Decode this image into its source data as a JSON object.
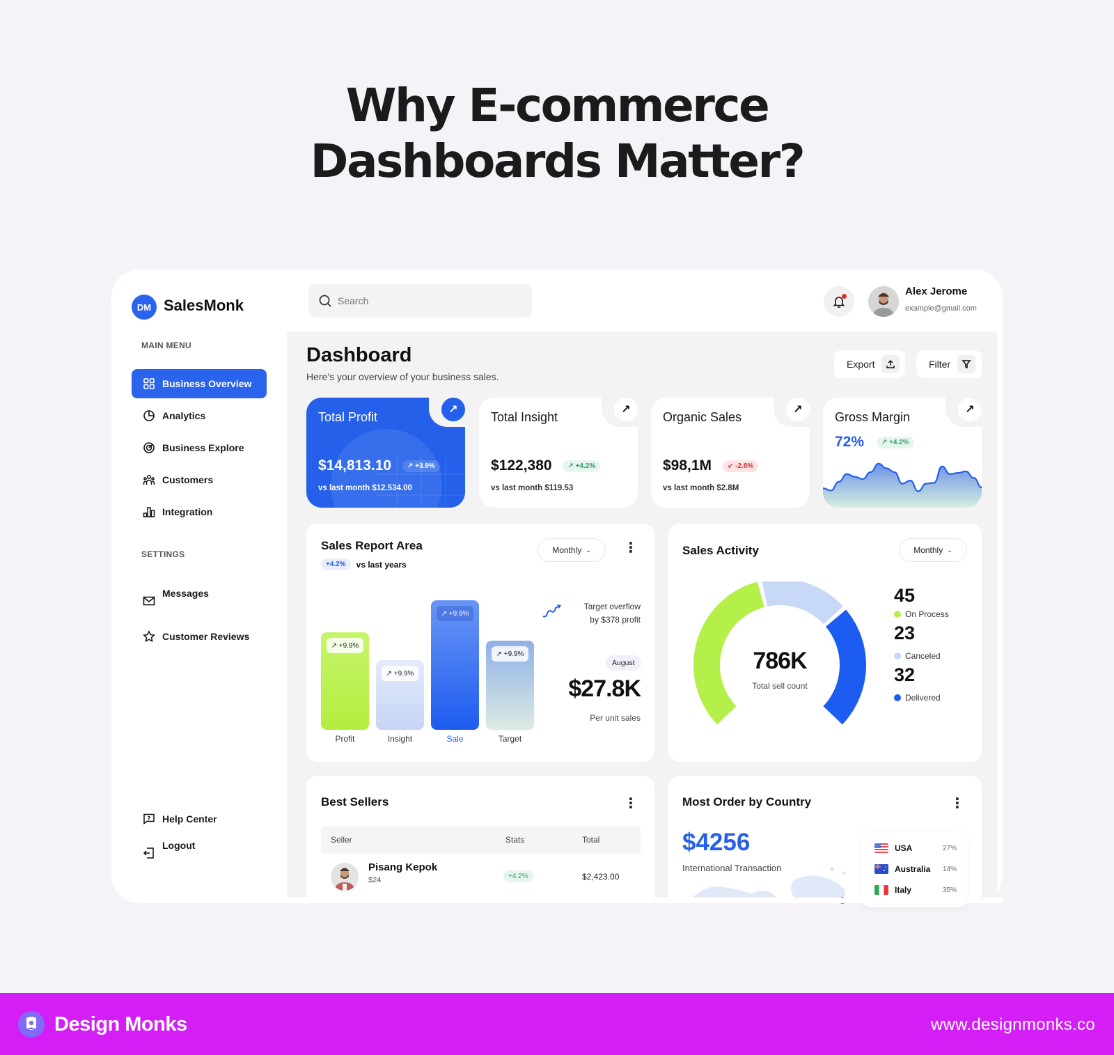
{
  "headline": {
    "line1": "Why E-commerce",
    "line2": "Dashboards Matter?"
  },
  "app": {
    "logo_initials": "DM",
    "name": "SalesMonk"
  },
  "sidebar": {
    "main_menu_label": "MAIN MENU",
    "main_items": [
      {
        "label": "Business Overview",
        "icon": "grid-icon",
        "active": true
      },
      {
        "label": "Analytics",
        "icon": "pie-chart-icon",
        "active": false
      },
      {
        "label": "Business Explore",
        "icon": "target-icon",
        "active": false
      },
      {
        "label": "Customers",
        "icon": "users-icon",
        "active": false
      },
      {
        "label": "Integration",
        "icon": "bar-chart-icon",
        "active": false
      }
    ],
    "settings_label": "SETTINGS",
    "settings_items": [
      {
        "label": "Messages",
        "icon": "mail-icon"
      },
      {
        "label": "Customer Reviews",
        "icon": "star-icon"
      }
    ],
    "bottom_items": [
      {
        "label": "Help Center",
        "icon": "help-icon"
      },
      {
        "label": "Logout",
        "icon": "logout-icon"
      }
    ]
  },
  "topbar": {
    "search_placeholder": "Search",
    "notification_unread": true,
    "user_name": "Alex Jerome",
    "user_email": "example@gmail.com"
  },
  "page": {
    "title": "Dashboard",
    "subtitle": "Here's your overview of your business sales.",
    "export_label": "Export",
    "filter_label": "Filter"
  },
  "stats": [
    {
      "title": "Total Profit",
      "value": "$14,813.10",
      "change": "↗ +3.9%",
      "trend": "up",
      "compare": "vs last month $12.534.00"
    },
    {
      "title": "Total Insight",
      "value": "$122,380",
      "change": "↗ +4.2%",
      "trend": "up",
      "compare": "vs last month $119.53"
    },
    {
      "title": "Organic Sales",
      "value": "$98,1M",
      "change": "↙ -2.8%",
      "trend": "down",
      "compare": "vs last month $2.8M"
    },
    {
      "title": "Gross Margin",
      "value": "72%",
      "change": "↗ +4.2%",
      "trend": "up"
    }
  ],
  "gross_margin_sparkline": [
    0.18,
    0.12,
    0.35,
    0.55,
    0.48,
    0.42,
    0.6,
    0.82,
    0.7,
    0.6,
    0.3,
    0.38,
    0.1,
    0.3,
    0.32,
    0.75,
    0.55,
    0.58,
    0.62,
    0.45,
    0.2
  ],
  "sales_report": {
    "title": "Sales Report Area",
    "change": "+4.2%",
    "change_label": "vs last years",
    "period": "Monthly",
    "note_line1": "Target overflow",
    "note_line2": "by $378 profit",
    "month": "August",
    "amount": "$27.8K",
    "amount_label": "Per unit sales"
  },
  "chart_data": [
    {
      "type": "bar",
      "title": "Sales Report Area",
      "categories": [
        "Profit",
        "Insight",
        "Sale",
        "Target"
      ],
      "values": [
        70,
        50,
        93,
        64
      ],
      "value_units": "relative height (% of max, estimated)",
      "bar_labels": [
        "↗ +9.9%",
        "↗ +9.9%",
        "↗ +9.9%",
        "↗ +9.9%"
      ],
      "highlighted": "Sale",
      "xlabel": "",
      "ylabel": "",
      "ylim": [
        0,
        100
      ]
    },
    {
      "type": "pie",
      "title": "Sales Activity",
      "center_value": "786K",
      "center_label": "Total sell count",
      "series": [
        {
          "name": "On Process",
          "value": 45,
          "color": "#b5ef4a"
        },
        {
          "name": "Canceled",
          "value": 23,
          "color": "#c8d8f7"
        },
        {
          "name": "Delivered",
          "value": 32,
          "color": "#1d5cf0"
        }
      ]
    }
  ],
  "sales_activity": {
    "title": "Sales Activity",
    "period": "Monthly",
    "center_value": "786K",
    "center_label": "Total sell count",
    "legend": [
      {
        "value": "45",
        "label": "On Process"
      },
      {
        "value": "23",
        "label": "Canceled"
      },
      {
        "value": "32",
        "label": "Delivered"
      }
    ]
  },
  "best_sellers": {
    "title": "Best Sellers",
    "columns": [
      "Seller",
      "Stats",
      "Total"
    ],
    "rows": [
      {
        "name": "Pisang Kepok",
        "price": "$24",
        "stats": "+4.2%",
        "total": "$2,423.00"
      }
    ]
  },
  "country": {
    "title": "Most Order by Country",
    "amount": "$4256",
    "amount_label": "International Transaction",
    "items": [
      {
        "name": "USA",
        "pct": "27%"
      },
      {
        "name": "Australia",
        "pct": "14%"
      },
      {
        "name": "Italy",
        "pct": "35%"
      }
    ]
  },
  "footer": {
    "brand": "Design Monks",
    "url": "www.designmonks.co"
  },
  "colors": {
    "primary": "#2460ea",
    "lime": "#b5ef4a",
    "footer": "#d31ff6",
    "positive": "#2f9e65",
    "negative": "#d8343b"
  }
}
